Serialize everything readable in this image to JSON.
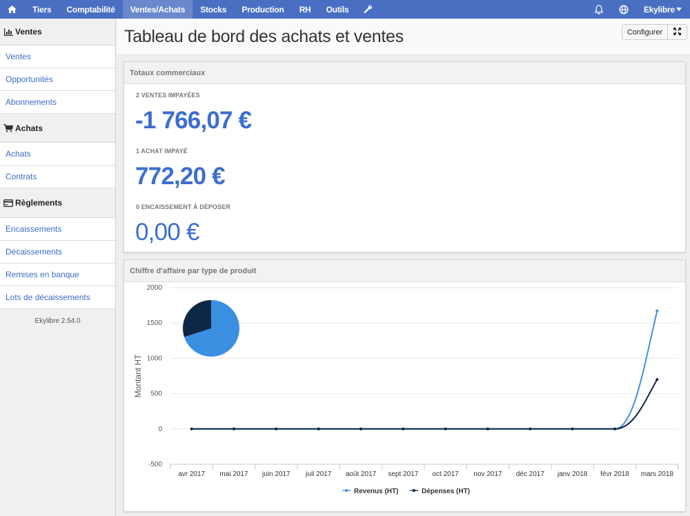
{
  "nav": {
    "items": [
      "Tiers",
      "Comptabilité",
      "Ventes/Achats",
      "Stocks",
      "Production",
      "RH",
      "Outils"
    ],
    "active": "Ventes/Achats",
    "user": "Ekylibre"
  },
  "sidebar": {
    "sections": [
      {
        "title": "Ventes",
        "icon": "bar-chart-icon",
        "items": [
          "Ventes",
          "Opportunités",
          "Abonnements"
        ]
      },
      {
        "title": "Achats",
        "icon": "cart-icon",
        "items": [
          "Achats",
          "Contrats"
        ]
      },
      {
        "title": "Règlements",
        "icon": "credit-card-icon",
        "items": [
          "Encaissements",
          "Décaissements",
          "Remises en banque",
          "Lots de décaissements"
        ]
      }
    ],
    "version": "Ekylibre 2.54.0"
  },
  "page": {
    "title": "Tableau de bord des achats et ventes",
    "configure_label": "Configurer"
  },
  "totals": {
    "title": "Totaux commerciaux",
    "items": [
      {
        "label": "2 VENTES IMPAYÉES",
        "value": "-1 766,07 €"
      },
      {
        "label": "1 ACHAT IMPAYÉ",
        "value": "772,20 €"
      },
      {
        "label": "0 ENCAISSEMENT À DÉPOSER",
        "value": "0,00 €"
      }
    ]
  },
  "colors": {
    "accent": "#4a6fc2",
    "value": "#3d6ecf",
    "revenus": "#3b8fe0",
    "depenses": "#0d2747"
  },
  "chart_data": {
    "type": "line",
    "title": "Chiffre d'affaire par type de produit",
    "ylabel": "Montant HT",
    "ylim": [
      -500,
      2000
    ],
    "yticks": [
      2000,
      1500,
      1000,
      500,
      0,
      -500
    ],
    "categories": [
      "avr 2017",
      "mai 2017",
      "juin 2017",
      "juil 2017",
      "août 2017",
      "sept 2017",
      "oct 2017",
      "nov 2017",
      "déc 2017",
      "janv 2018",
      "févr 2018",
      "mars 2018"
    ],
    "series": [
      {
        "name": "Revenus (HT)",
        "color": "#3b8fe0",
        "values": [
          0,
          0,
          0,
          0,
          0,
          0,
          0,
          0,
          0,
          0,
          0,
          1670
        ]
      },
      {
        "name": "Dépenses (HT)",
        "color": "#0d2747",
        "values": [
          0,
          0,
          0,
          0,
          0,
          0,
          0,
          0,
          0,
          0,
          0,
          700
        ]
      }
    ],
    "pie": [
      {
        "color": "#3b8fe0",
        "value": 70
      },
      {
        "color": "#0d2747",
        "value": 30
      }
    ]
  }
}
